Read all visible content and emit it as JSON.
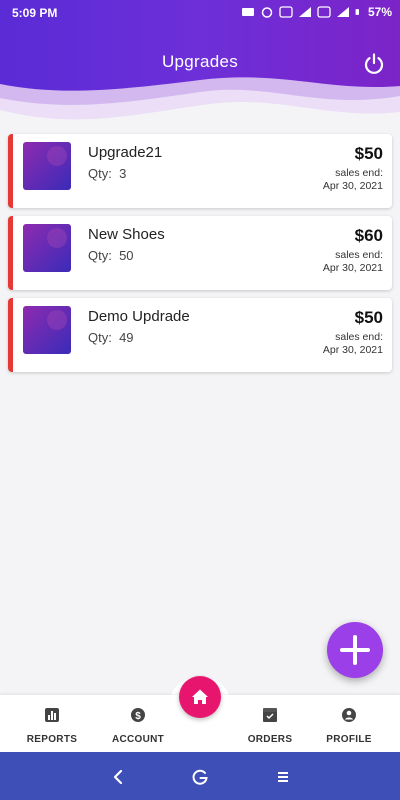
{
  "status_bar": {
    "time": "5:09 PM",
    "battery": "57%"
  },
  "header": {
    "title": "Upgrades",
    "power_icon": "power-icon"
  },
  "upgrades": [
    {
      "name": "Upgrade21",
      "qty_label": "Qty:",
      "qty": "3",
      "price": "$50",
      "ends_label": "sales end:",
      "ends_date": "Apr 30, 2021"
    },
    {
      "name": "New Shoes",
      "qty_label": "Qty:",
      "qty": "50",
      "price": "$60",
      "ends_label": "sales end:",
      "ends_date": "Apr 30, 2021"
    },
    {
      "name": "Demo Updrade",
      "qty_label": "Qty:",
      "qty": "49",
      "price": "$50",
      "ends_label": "sales end:",
      "ends_date": "Apr 30, 2021"
    }
  ],
  "bottom_nav": {
    "reports": "REPORTS",
    "account": "ACCOUNT",
    "orders": "ORDERS",
    "profile": "PROFILE"
  },
  "colors": {
    "accent": "#9b3fe8",
    "home": "#e8156e",
    "stripe": "#e53935",
    "sysnav": "#3f4fb8"
  }
}
